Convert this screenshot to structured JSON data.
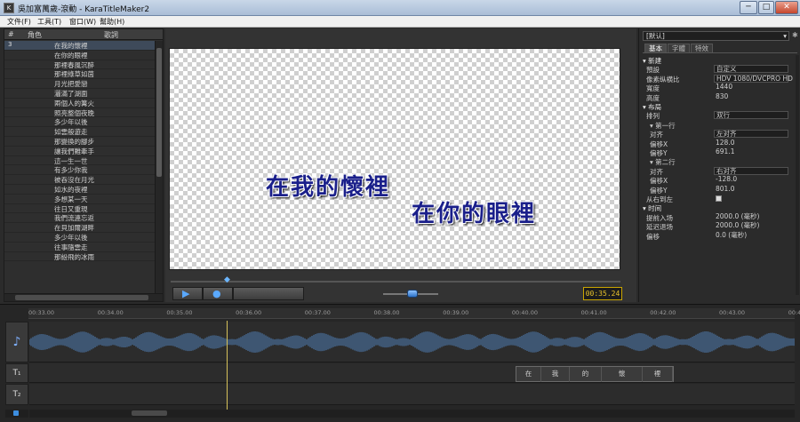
{
  "window": {
    "title": "吳加富萬歲-滾動 - KaraTitleMaker2",
    "minimize": "─",
    "maximize": "□",
    "close": "✕"
  },
  "menu": [
    {
      "label": "文件(F)"
    },
    {
      "label": "工具(T)"
    },
    {
      "label": "窗口(W)"
    },
    {
      "label": "幫助(H)"
    }
  ],
  "lyrics": {
    "col_num": "#",
    "col_role": "角色",
    "col_lyric": "歌詞",
    "rows": [
      {
        "num": "3",
        "text": "在我的懷裡"
      },
      {
        "num": "",
        "text": "在你的眼裡"
      },
      {
        "num": "",
        "text": "那裡春風沉醉"
      },
      {
        "num": "",
        "text": "那裡綠草如茵"
      },
      {
        "num": "",
        "text": "月光把愛戀"
      },
      {
        "num": "",
        "text": "灑滿了湖面"
      },
      {
        "num": "",
        "text": "兩個人的篝火"
      },
      {
        "num": "",
        "text": "照亮整個夜晚"
      },
      {
        "num": "",
        "text": "多少年以後"
      },
      {
        "num": "",
        "text": "如雲般遊走"
      },
      {
        "num": "",
        "text": "那變換的腳步"
      },
      {
        "num": "",
        "text": "讓我們難牽手"
      },
      {
        "num": "",
        "text": "這一生一世"
      },
      {
        "num": "",
        "text": "有多少你我"
      },
      {
        "num": "",
        "text": "被吞沒在月光"
      },
      {
        "num": "",
        "text": "如水的夜裡"
      },
      {
        "num": "",
        "text": "多想某一天"
      },
      {
        "num": "",
        "text": "往日又重現"
      },
      {
        "num": "",
        "text": "我們流連忘返"
      },
      {
        "num": "",
        "text": "在貝加爾湖畔"
      },
      {
        "num": "",
        "text": "多少年以後"
      },
      {
        "num": "",
        "text": "往事隨雲走"
      },
      {
        "num": "",
        "text": "那紛飛的冰雨"
      }
    ]
  },
  "preview": {
    "line1": "在我的懷裡",
    "line2": "在你的眼裡",
    "timecode": "00:35.24",
    "play_icon": "▶",
    "stop_icon": "●"
  },
  "properties": {
    "preset_combo": "[默认]",
    "tabs": [
      "基本",
      "字體",
      "特效"
    ],
    "rows": [
      {
        "kind": "section",
        "label": "▾ 新建",
        "value": ""
      },
      {
        "kind": "field",
        "label": "預設",
        "value": "自定义"
      },
      {
        "kind": "field",
        "label": "像素纵横比",
        "value": "HDV 1080/DVCPRO HD"
      },
      {
        "kind": "field",
        "label": "寬度",
        "value": "1440"
      },
      {
        "kind": "field",
        "label": "高度",
        "value": "830"
      },
      {
        "kind": "section",
        "label": "▾ 布局",
        "value": ""
      },
      {
        "kind": "field",
        "label": "排列",
        "value": "双行"
      },
      {
        "kind": "subsection",
        "label": "▾ 第一行",
        "value": ""
      },
      {
        "kind": "subfield",
        "label": "对齐",
        "value": "左对齐"
      },
      {
        "kind": "subfield",
        "label": "偏移X",
        "value": "128.0"
      },
      {
        "kind": "subfield",
        "label": "偏移Y",
        "value": "691.1"
      },
      {
        "kind": "subsection",
        "label": "▾ 第二行",
        "value": ""
      },
      {
        "kind": "subfield",
        "label": "对齐",
        "value": "右对齐"
      },
      {
        "kind": "subfield",
        "label": "偏移X",
        "value": "-128.0"
      },
      {
        "kind": "subfield",
        "label": "偏移Y",
        "value": "801.0"
      },
      {
        "kind": "check",
        "label": "从右到左",
        "value": ""
      },
      {
        "kind": "section",
        "label": "▾ 时间",
        "value": ""
      },
      {
        "kind": "field",
        "label": "提前入场",
        "value": "2000.0 (毫秒)"
      },
      {
        "kind": "field",
        "label": "延迟退场",
        "value": "2000.0 (毫秒)"
      },
      {
        "kind": "field",
        "label": "偏移",
        "value": "0.0 (毫秒)"
      }
    ]
  },
  "timeline": {
    "ticks": [
      "00:33.00",
      "00:34.00",
      "00:35.00",
      "00:36.00",
      "00:37.00",
      "00:38.00",
      "00:39.00",
      "00:40.00",
      "00:41.00",
      "00:42.00",
      "00:43.00",
      "00:44.00"
    ],
    "track_audio_icon": "♪",
    "track_t1_icon": "T₁",
    "track_t2_icon": "T₂",
    "clip_chars": [
      "在",
      "我",
      "的",
      "懷",
      "裡"
    ]
  }
}
